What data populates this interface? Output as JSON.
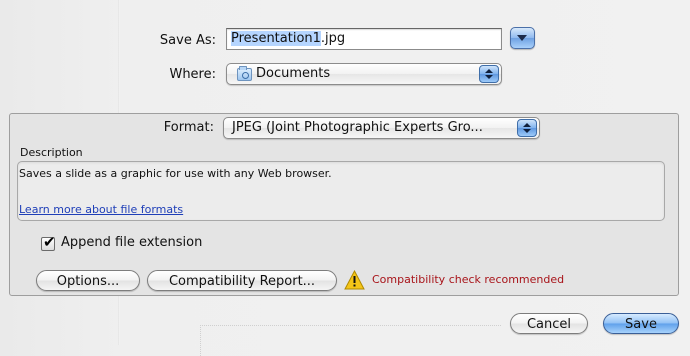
{
  "save_as": {
    "label": "Save As:",
    "filename_selected": "Presentation1",
    "filename_extension": ".jpg"
  },
  "where": {
    "label": "Where:",
    "value": "Documents",
    "icon": "folder-icon"
  },
  "format": {
    "label": "Format:",
    "value": "JPEG (Joint Photographic Experts Gro..."
  },
  "description": {
    "label": "Description",
    "text": "Saves a slide as a graphic for use with any Web browser.",
    "link": "Learn more about file formats"
  },
  "append_extension": {
    "label": "Append file extension",
    "checked": true
  },
  "buttons": {
    "options": "Options...",
    "compatibility_report": "Compatibility Report...",
    "cancel": "Cancel",
    "save": "Save"
  },
  "compatibility_warning": {
    "text": "Compatibility check recommended",
    "icon": "warning-icon",
    "color": "#a8141a"
  },
  "colors": {
    "accent_blue": "#6fa1e2",
    "link": "#1f3fb8",
    "warning_yellow": "#f5c518"
  }
}
